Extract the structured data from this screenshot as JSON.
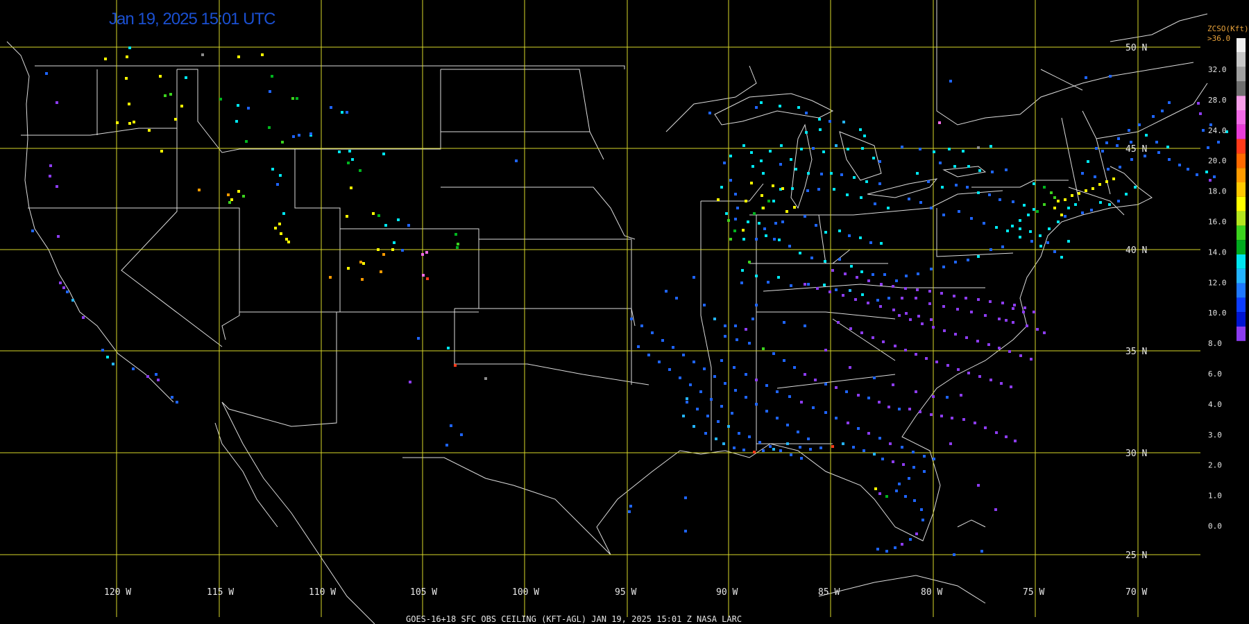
{
  "timestamp": "Jan 19, 2025 15:01 UTC",
  "footer": "GOES-16+18  SFC OBS CEILING (KFT-AGL)   JAN 19, 2025 15:01 Z   NASA LARC",
  "grid": {
    "lat_labels": [
      "50 N",
      "45 N",
      "40 N",
      "35 N",
      "30 N",
      "25 N"
    ],
    "lon_labels": [
      "120 W",
      "115 W",
      "110 W",
      "105 W",
      "100 W",
      "95 W",
      "90 W",
      "85 W",
      "80 W",
      "75 W",
      "70 W"
    ],
    "line_color": "#d8d82a"
  },
  "colorbar": {
    "title": "ZCSO(Kft)",
    "top_label": ">36.0",
    "labels": [
      "32.0",
      "28.0",
      "24.0",
      "20.0",
      "18.0",
      "16.0",
      "14.0",
      "12.0",
      "10.0",
      "8.0",
      "6.0",
      "4.0",
      "3.0",
      "2.0",
      "1.0",
      "0.0"
    ],
    "colors": [
      "#f0f0f0",
      "#c8c8c8",
      "#a0a0a0",
      "#6e6e6e",
      "#f7a0e8",
      "#f26be6",
      "#e83cd8",
      "#ff3a1a",
      "#ff6a00",
      "#ff9b00",
      "#ffc800",
      "#ffff00",
      "#b4e61e",
      "#3cd21e",
      "#00aa1e",
      "#00e6f0",
      "#24b4ff",
      "#1e78ff",
      "#0c3cff",
      "#0014d2",
      "#8c3cf0"
    ]
  },
  "stations": {
    "colors": {
      "v": "#8c3cf0",
      "db": "#0014d2",
      "b": "#1e64ff",
      "lb": "#24b4ff",
      "c": "#00e6f0",
      "g": "#00b41e",
      "lg": "#3cd21e",
      "y": "#ffff00",
      "o": "#ff9b00",
      "r": "#ff3a1a",
      "p": "#f26be6",
      "gr": "#8c8c8c"
    }
  }
}
